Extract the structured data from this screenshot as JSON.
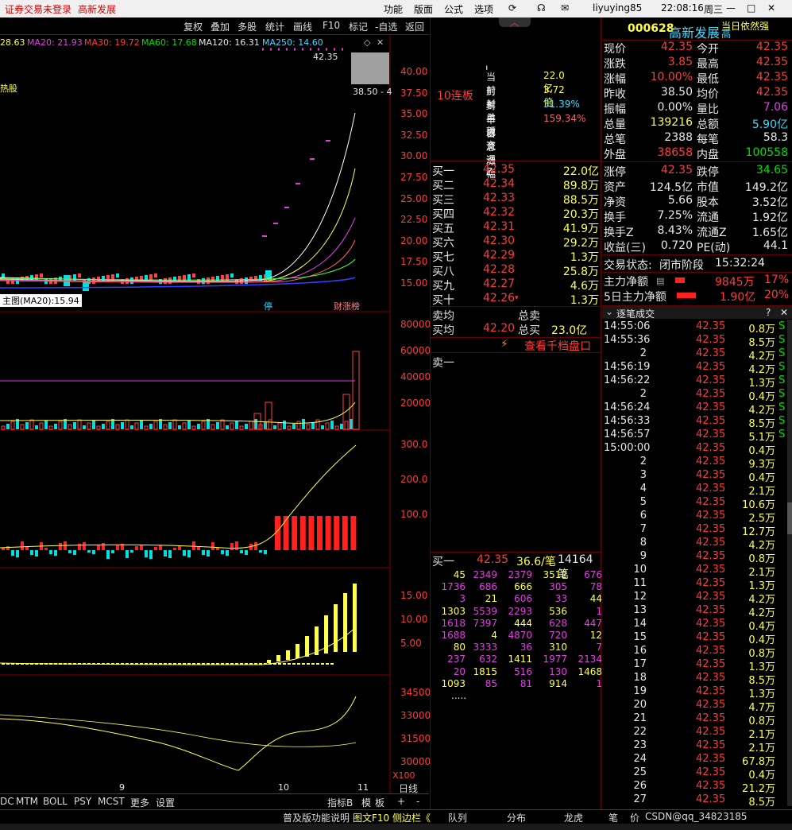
{
  "topbar": {
    "status": "证券交易未登录",
    "stock": "高新发展",
    "menus": [
      "功能",
      "版面",
      "公式",
      "选项"
    ],
    "user": "liyuying85",
    "time": "22:08:16",
    "weekday": "周三"
  },
  "toolbar": [
    "复权",
    "叠加",
    "多股",
    "统计",
    "画线",
    "F10",
    "标记",
    "-自选",
    "返回"
  ],
  "ma": {
    "first": "28.63",
    "ma20": "MA20: 21.93",
    "ma30": "MA30: 19.72",
    "ma60": "MA60: 17.68",
    "ma120": "MA120: 16.31",
    "ma250": "MA250: 14.60"
  },
  "chart": {
    "hot": "热股",
    "peak": "42.35",
    "range_text": "38.50 - 4",
    "price_axis": [
      "40.00",
      "37.50",
      "35.00",
      "32.50",
      "30.00",
      "27.50",
      "25.00",
      "22.50",
      "20.00",
      "17.50",
      "15.00"
    ],
    "ma20_tip": "主图(MA20):15.94",
    "ting": "停",
    "caizhang": "财涨榜",
    "vol_axis": [
      "80000",
      "60000",
      "40000",
      "20000"
    ],
    "p3_axis": [
      "300.0",
      "200.0",
      "100.0"
    ],
    "p4_axis": [
      "15.00",
      "10.00",
      "5.00"
    ],
    "p5_axis": [
      "34500",
      "33000",
      "31500",
      "30000"
    ],
    "x100": "X100",
    "month9": "9",
    "month10": "10",
    "month11": "11"
  },
  "bottombar": {
    "tabs": [
      "DC",
      "MTM",
      "BOLL",
      "PSY",
      "MCST",
      "更多",
      "设置"
    ],
    "right": [
      "指标B",
      "模",
      "板",
      "日线",
      "+",
      "-"
    ]
  },
  "statusbar": {
    "items": [
      "普及版功能说明",
      "图文F10",
      "侧边栏《",
      "队列",
      "分布",
      "龙虎",
      "笔",
      "价",
      "CSDN@qq_34823185"
    ]
  },
  "mid": {
    "lianban": "10连板",
    "info": [
      {
        "k": "当前封单额",
        "v": "22.0亿"
      },
      {
        "k": "封单占成交",
        "v": "3.72倍"
      },
      {
        "k": "封单占流通Z",
        "v": "31.39%"
      },
      {
        "k": "十日总涨幅",
        "v": "159.34%"
      }
    ],
    "buy": [
      {
        "n": "买一",
        "p": "42.35",
        "v": "22.0亿"
      },
      {
        "n": "买二",
        "p": "42.34",
        "v": "89.8万"
      },
      {
        "n": "买三",
        "p": "42.33",
        "v": "88.5万"
      },
      {
        "n": "买四",
        "p": "42.32",
        "v": "20.3万"
      },
      {
        "n": "买五",
        "p": "42.31",
        "v": "41.9万"
      },
      {
        "n": "买六",
        "p": "42.30",
        "v": "29.2万"
      },
      {
        "n": "买七",
        "p": "42.29",
        "v": "1.3万"
      },
      {
        "n": "买八",
        "p": "42.28",
        "v": "25.8万"
      },
      {
        "n": "买九",
        "p": "42.27",
        "v": "4.6万"
      },
      {
        "n": "买十",
        "p": "42.26",
        "v": "1.3万"
      }
    ],
    "sell_avg": "卖均",
    "total_sell": "总卖",
    "buy_avg": "买均",
    "buy_avg_v": "42.20",
    "total_buy": "总买",
    "total_buy_v": "23.0亿",
    "qiandang": "查看千档盘口",
    "maiyi": "卖一",
    "queue_head": {
      "n": "买一",
      "p": "42.35",
      "v": "36.6/笔",
      "c": "14164笔"
    },
    "queue": [
      [
        "45",
        "2349",
        "2379",
        "3512",
        "676"
      ],
      [
        "1736",
        "686",
        "666",
        "305",
        "78"
      ],
      [
        "3",
        "21",
        "606",
        "33",
        "44"
      ],
      [
        "1303",
        "5539",
        "2293",
        "536",
        "1"
      ],
      [
        "1618",
        "7397",
        "444",
        "628",
        "447"
      ],
      [
        "1688",
        "4",
        "4870",
        "720",
        "12"
      ],
      [
        "80",
        "3333",
        "36",
        "310",
        "7"
      ],
      [
        "237",
        "632",
        "1411",
        "1977",
        "2134"
      ],
      [
        "20",
        "1815",
        "516",
        "130",
        "1468"
      ],
      [
        "1093",
        "85",
        "81",
        "914",
        "1"
      ]
    ],
    "more": "....."
  },
  "right": {
    "code": "000628",
    "name": "高新发展",
    "tag": "当日依然强",
    "tag2": "高",
    "quote": [
      [
        {
          "k": "现价",
          "v": "42.35",
          "c": "r"
        },
        {
          "k": "今开",
          "v": "42.35",
          "c": "r"
        }
      ],
      [
        {
          "k": "涨跌",
          "v": "3.85",
          "c": "r"
        },
        {
          "k": "最高",
          "v": "42.35",
          "c": "r"
        }
      ],
      [
        {
          "k": "涨幅",
          "v": "10.00%",
          "c": "r"
        },
        {
          "k": "最低",
          "v": "42.35",
          "c": "r"
        }
      ],
      [
        {
          "k": "昨收",
          "v": "38.50",
          "c": "w"
        },
        {
          "k": "均价",
          "v": "42.35",
          "c": "r"
        }
      ],
      [
        {
          "k": "振幅",
          "v": "0.00%",
          "c": "w"
        },
        {
          "k": "量比",
          "v": "7.06",
          "c": "m"
        }
      ],
      [
        {
          "k": "总量",
          "v": "139216",
          "c": "y"
        },
        {
          "k": "总额",
          "v": "5.90亿",
          "c": "c"
        }
      ],
      [
        {
          "k": "总笔",
          "v": "2388",
          "c": "w"
        },
        {
          "k": "每笔",
          "v": "58.3",
          "c": "w"
        }
      ],
      [
        {
          "k": "外盘",
          "v": "38658",
          "c": "r"
        },
        {
          "k": "内盘",
          "v": "100558",
          "c": "g"
        }
      ]
    ],
    "stats": [
      [
        {
          "k": "涨停",
          "v": "42.35",
          "c": "r"
        },
        {
          "k": "跌停",
          "v": "34.65",
          "c": "g"
        }
      ],
      [
        {
          "k": "资产",
          "v": "124.5亿",
          "c": "w"
        },
        {
          "k": "市值",
          "v": "149.2亿",
          "c": "w"
        }
      ],
      [
        {
          "k": "净资",
          "v": "5.66",
          "c": "w"
        },
        {
          "k": "股本",
          "v": "3.52亿",
          "c": "w"
        }
      ],
      [
        {
          "k": "换手",
          "v": "7.25%",
          "c": "w"
        },
        {
          "k": "流通",
          "v": "1.92亿",
          "c": "w"
        }
      ],
      [
        {
          "k": "换手Z",
          "v": "8.43%",
          "c": "w"
        },
        {
          "k": "流通Z",
          "v": "1.65亿",
          "c": "w"
        }
      ],
      [
        {
          "k": "收益(三)",
          "v": "0.720",
          "c": "w"
        },
        {
          "k": "PE(动)",
          "v": "44.1",
          "c": "w"
        }
      ]
    ],
    "trade_state": "交易状态:",
    "trade_state_v": "闭市阶段",
    "trade_time": "15:32:24",
    "flow": [
      {
        "k": "主力净额",
        "v": "9845万",
        "p": "17%"
      },
      {
        "k": "5日主力净额",
        "v": "1.90亿",
        "p": "20%"
      }
    ],
    "tick_title": "逐笔成交",
    "tick_q": "?",
    "ticks": [
      {
        "t": "14:55:06",
        "p": "42.35",
        "v": "0.8万",
        "s": "S"
      },
      {
        "t": "14:55:36",
        "p": "42.35",
        "v": "8.5万",
        "s": "S"
      },
      {
        "t": "2",
        "p": "42.35",
        "v": "4.2万",
        "s": "S"
      },
      {
        "t": "14:56:19",
        "p": "42.35",
        "v": "4.2万",
        "s": "S"
      },
      {
        "t": "14:56:22",
        "p": "42.35",
        "v": "1.3万",
        "s": "S"
      },
      {
        "t": "2",
        "p": "42.35",
        "v": "0.4万",
        "s": "S"
      },
      {
        "t": "14:56:24",
        "p": "42.35",
        "v": "4.2万",
        "s": "S"
      },
      {
        "t": "14:56:33",
        "p": "42.35",
        "v": "8.5万",
        "s": "S"
      },
      {
        "t": "14:56:57",
        "p": "42.35",
        "v": "5.1万",
        "s": "S"
      },
      {
        "t": "15:00:00",
        "p": "42.35",
        "v": "0.4万",
        "s": ""
      },
      {
        "t": "2",
        "p": "42.35",
        "v": "9.3万",
        "s": ""
      },
      {
        "t": "3",
        "p": "42.35",
        "v": "0.4万",
        "s": ""
      },
      {
        "t": "4",
        "p": "42.35",
        "v": "2.1万",
        "s": ""
      },
      {
        "t": "5",
        "p": "42.35",
        "v": "10.6万",
        "s": ""
      },
      {
        "t": "6",
        "p": "42.35",
        "v": "2.5万",
        "s": ""
      },
      {
        "t": "7",
        "p": "42.35",
        "v": "12.7万",
        "s": ""
      },
      {
        "t": "8",
        "p": "42.35",
        "v": "4.2万",
        "s": ""
      },
      {
        "t": "9",
        "p": "42.35",
        "v": "0.8万",
        "s": ""
      },
      {
        "t": "10",
        "p": "42.35",
        "v": "2.1万",
        "s": ""
      },
      {
        "t": "11",
        "p": "42.35",
        "v": "1.3万",
        "s": ""
      },
      {
        "t": "12",
        "p": "42.35",
        "v": "4.2万",
        "s": ""
      },
      {
        "t": "13",
        "p": "42.35",
        "v": "4.2万",
        "s": ""
      },
      {
        "t": "14",
        "p": "42.35",
        "v": "0.4万",
        "s": ""
      },
      {
        "t": "15",
        "p": "42.35",
        "v": "0.4万",
        "s": ""
      },
      {
        "t": "16",
        "p": "42.35",
        "v": "0.8万",
        "s": ""
      },
      {
        "t": "17",
        "p": "42.35",
        "v": "1.3万",
        "s": ""
      },
      {
        "t": "18",
        "p": "42.35",
        "v": "8.5万",
        "s": ""
      },
      {
        "t": "19",
        "p": "42.35",
        "v": "1.3万",
        "s": ""
      },
      {
        "t": "20",
        "p": "42.35",
        "v": "4.7万",
        "s": ""
      },
      {
        "t": "21",
        "p": "42.35",
        "v": "0.8万",
        "s": ""
      },
      {
        "t": "22",
        "p": "42.35",
        "v": "2.1万",
        "s": ""
      },
      {
        "t": "23",
        "p": "42.35",
        "v": "2.1万",
        "s": ""
      },
      {
        "t": "24",
        "p": "42.35",
        "v": "67.8万",
        "s": ""
      },
      {
        "t": "25",
        "p": "42.35",
        "v": "0.4万",
        "s": ""
      },
      {
        "t": "26",
        "p": "42.35",
        "v": "21.2万",
        "s": ""
      },
      {
        "t": "27",
        "p": "42.35",
        "v": "8.5万",
        "s": ""
      }
    ]
  },
  "colors": {
    "up": "#ff3b3b",
    "down": "#00e0e0",
    "yellow": "#ffff50",
    "magenta": "#e040e0"
  }
}
